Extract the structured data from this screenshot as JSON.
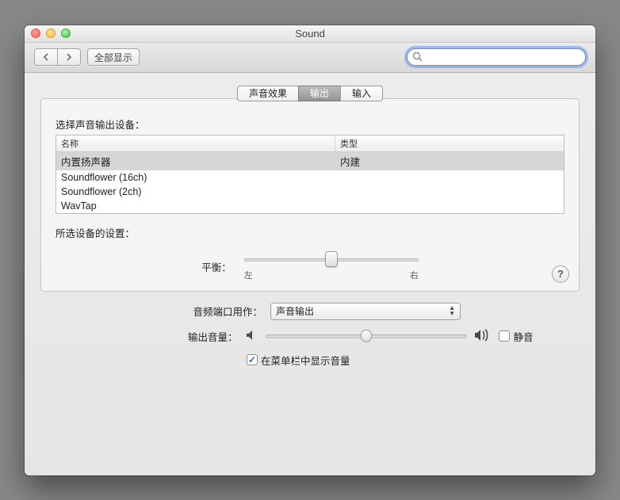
{
  "window": {
    "title": "Sound"
  },
  "toolbar": {
    "show_all": "全部显示",
    "search_placeholder": ""
  },
  "tabs": {
    "effects": "声音效果",
    "output": "输出",
    "input": "输入",
    "active": "output"
  },
  "output": {
    "select_label": "选择声音输出设备：",
    "col_name": "名称",
    "col_type": "类型",
    "devices": [
      {
        "name": "内置扬声器",
        "type": "内建",
        "selected": true
      },
      {
        "name": "Soundflower (16ch)",
        "type": "",
        "selected": false
      },
      {
        "name": "Soundflower (2ch)",
        "type": "",
        "selected": false
      },
      {
        "name": "WavTap",
        "type": "",
        "selected": false
      }
    ],
    "settings_label": "所选设备的设置：",
    "balance_label": "平衡：",
    "balance_left": "左",
    "balance_right": "右",
    "balance_value": 0.5
  },
  "bottom": {
    "port_label": "音频端口用作：",
    "port_value": "声音输出",
    "volume_label": "输出音量：",
    "volume_value": 0.5,
    "mute_label": "静音",
    "mute_checked": false,
    "show_in_menu_label": "在菜单栏中显示音量",
    "show_in_menu_checked": true
  }
}
